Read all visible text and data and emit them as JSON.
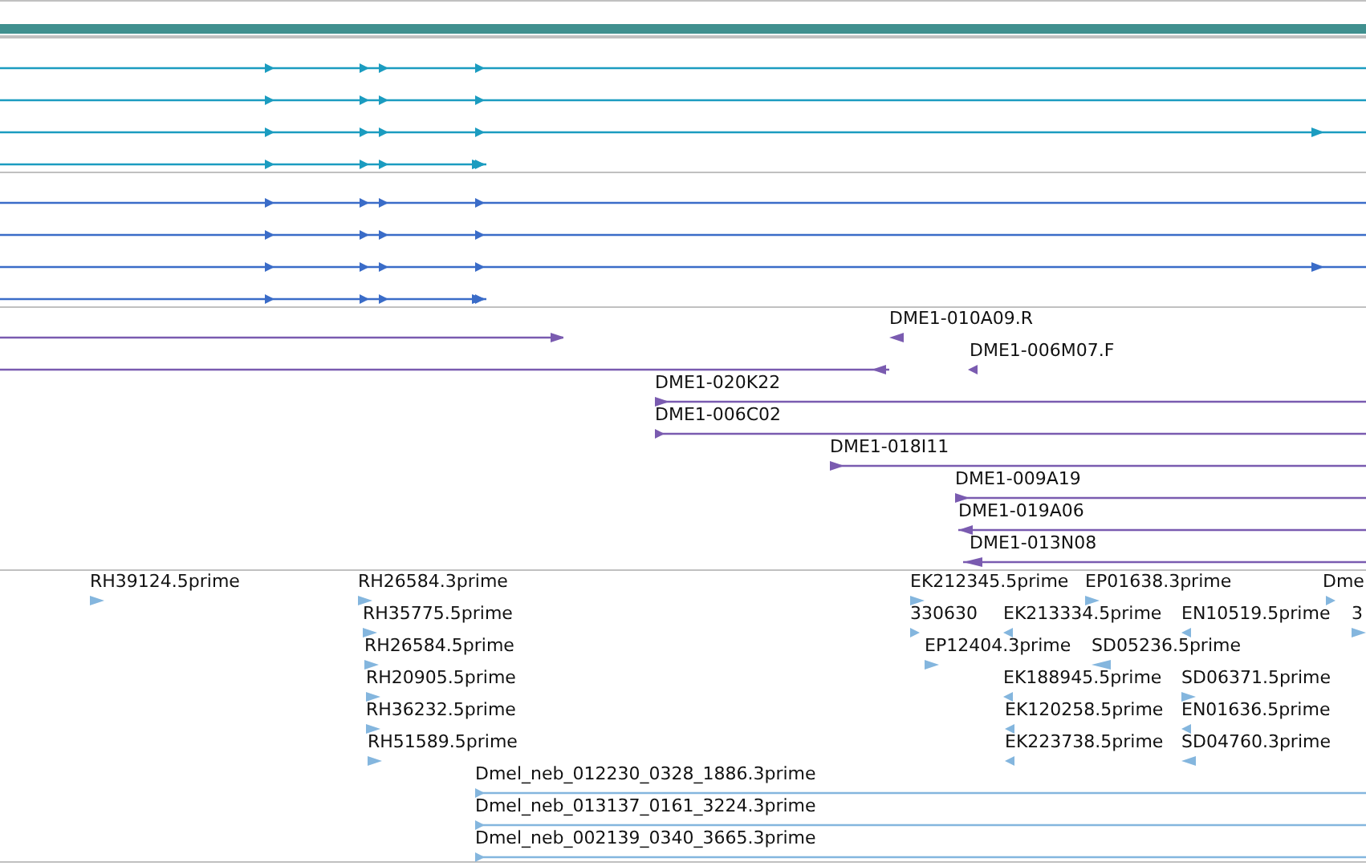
{
  "tracks": [
    {
      "kind": "gene",
      "color": "#1b9cc0",
      "transcripts": [
        {
          "reverse": false
        },
        {
          "reverse": false
        },
        {
          "reverse": false
        },
        {
          "reverse": false
        }
      ]
    },
    {
      "kind": "gene",
      "color": "#3a6cc8",
      "transcripts": [
        {
          "reverse": false
        },
        {
          "reverse": false
        },
        {
          "reverse": false
        },
        {
          "reverse": false
        }
      ]
    },
    {
      "kind": "feature",
      "color": "#7a5bb0",
      "rows": [
        {
          "features": [
            {
              "reverse": false
            },
            {
              "label": "DME1-010A09.R",
              "reverse": true
            }
          ]
        },
        {
          "features": [
            {
              "reverse": true
            },
            {
              "label": "DME1-006M07.F",
              "reverse": true
            }
          ]
        },
        {
          "features": [
            {
              "label": "DME1-020K22",
              "reverse": false
            }
          ]
        },
        {
          "features": [
            {
              "label": "DME1-006C02",
              "reverse": false
            }
          ]
        },
        {
          "features": [
            {
              "label": "DME1-018I11",
              "reverse": false
            }
          ]
        },
        {
          "features": [
            {
              "label": "DME1-009A19",
              "reverse": false
            }
          ]
        },
        {
          "features": [
            {
              "label": "DME1-019A06",
              "reverse": true
            }
          ]
        },
        {
          "features": [
            {
              "label": "DME1-013N08",
              "reverse": true
            }
          ]
        }
      ]
    },
    {
      "kind": "feature",
      "color": "#84b6de",
      "rows": [
        {
          "features": [
            {
              "label": "RH39124.5prime",
              "reverse": false
            },
            {
              "label": "RH26584.3prime",
              "reverse": false
            },
            {
              "label": "EK212345.5prime",
              "reverse": false
            },
            {
              "label": "EP01638.3prime",
              "reverse": false
            },
            {
              "label": "Dme",
              "reverse": false
            }
          ]
        },
        {
          "features": [
            {
              "label": "RH35775.5prime",
              "reverse": false
            },
            {
              "label": "330630",
              "reverse": false
            },
            {
              "label": "EK213334.5prime",
              "reverse": true
            },
            {
              "label": "EN10519.5prime",
              "reverse": true
            },
            {
              "label": "3",
              "reverse": false
            }
          ]
        },
        {
          "features": [
            {
              "label": "RH26584.5prime",
              "reverse": false
            },
            {
              "label": "EP12404.3prime",
              "reverse": false
            },
            {
              "label": "SD05236.5prime",
              "reverse": true
            }
          ]
        },
        {
          "features": [
            {
              "label": "RH20905.5prime",
              "reverse": false
            },
            {
              "label": "EK188945.5prime",
              "reverse": true
            },
            {
              "label": "SD06371.5prime",
              "reverse": false
            }
          ]
        },
        {
          "features": [
            {
              "label": "RH36232.5prime",
              "reverse": false
            },
            {
              "label": "EK120258.5prime",
              "reverse": true
            },
            {
              "label": "EN01636.5prime",
              "reverse": true
            }
          ]
        },
        {
          "features": [
            {
              "label": "RH51589.5prime",
              "reverse": false
            },
            {
              "label": "EK223738.5prime",
              "reverse": true
            },
            {
              "label": "SD04760.3prime",
              "reverse": true
            }
          ]
        },
        {
          "features": [
            {
              "label": "Dmel_neb_012230_0328_1886.3prime",
              "reverse": false
            }
          ]
        },
        {
          "features": [
            {
              "label": "Dmel_neb_013137_0161_3224.3prime",
              "reverse": false
            }
          ]
        },
        {
          "features": [
            {
              "label": "Dmel_neb_002139_0340_3665.3prime",
              "reverse": false
            }
          ]
        }
      ]
    }
  ]
}
